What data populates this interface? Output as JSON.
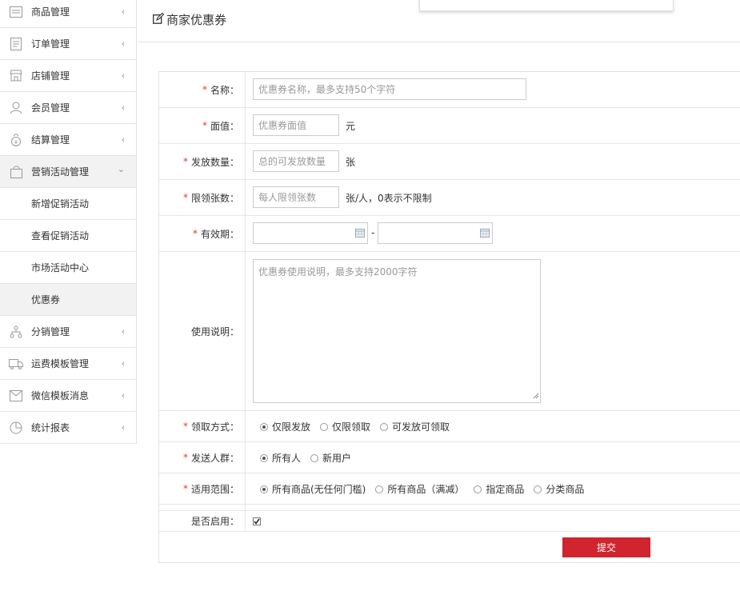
{
  "sidebar": {
    "items": [
      {
        "label": "商品管理",
        "icon": "product-list-icon",
        "chevron": "‹"
      },
      {
        "label": "订单管理",
        "icon": "order-doc-icon",
        "chevron": "‹"
      },
      {
        "label": "店铺管理",
        "icon": "store-icon",
        "chevron": "‹"
      },
      {
        "label": "会员管理",
        "icon": "member-user-icon",
        "chevron": "‹"
      },
      {
        "label": "结算管理",
        "icon": "money-bag-icon",
        "chevron": "‹"
      },
      {
        "label": "营销活动管理",
        "icon": "shopping-bag-icon",
        "chevron": "⌄"
      },
      {
        "label": "新增促销活动"
      },
      {
        "label": "查看促销活动"
      },
      {
        "label": "市场活动中心"
      },
      {
        "label": "优惠券"
      },
      {
        "label": "分销管理",
        "icon": "distribution-tree-icon",
        "chevron": "‹"
      },
      {
        "label": "运费模板管理",
        "icon": "shipping-truck-icon",
        "chevron": "‹"
      },
      {
        "label": "微信模板消息",
        "icon": "wechat-message-icon",
        "chevron": "‹"
      },
      {
        "label": "统计报表",
        "icon": "pie-chart-icon",
        "chevron": "‹"
      }
    ]
  },
  "header": {
    "title": "商家优惠券",
    "icon": "edit-icon"
  },
  "form": {
    "name": {
      "label": "名称：",
      "placeholder": "优惠券名称，最多支持50个字符"
    },
    "face_value": {
      "label": "面值：",
      "placeholder": "优惠券面值",
      "suffix": "元"
    },
    "quantity": {
      "label": "发放数量：",
      "placeholder": "总的可发放数量",
      "suffix": "张"
    },
    "limit": {
      "label": "限领张数：",
      "placeholder": "每人限领张数",
      "suffix": "张/人，0表示不限制"
    },
    "validity": {
      "label": "有效期：",
      "separator": "-",
      "icon": "calendar-icon"
    },
    "description": {
      "label": "使用说明：",
      "placeholder": "优惠券使用说明，最多支持2000字符"
    },
    "receive_method": {
      "label": "领取方式：",
      "options": [
        "仅限发放",
        "仅限领取",
        "可发放可领取"
      ],
      "selected": "仅限发放"
    },
    "audience": {
      "label": "发送人群：",
      "options": [
        "所有人",
        "新用户"
      ],
      "selected": "所有人"
    },
    "scope": {
      "label": "适用范围：",
      "options": [
        "所有商品(无任何门槛)",
        "所有商品（满减）",
        "指定商品",
        "分类商品"
      ],
      "selected": "所有商品(无任何门槛)"
    },
    "enabled": {
      "label": "是否启用：",
      "checked": true
    },
    "required_mark": "*",
    "submit_label": "提交"
  },
  "colors": {
    "accent": "#d0242e",
    "required": "#e4393c",
    "active_bg": "#f2f2f2"
  }
}
